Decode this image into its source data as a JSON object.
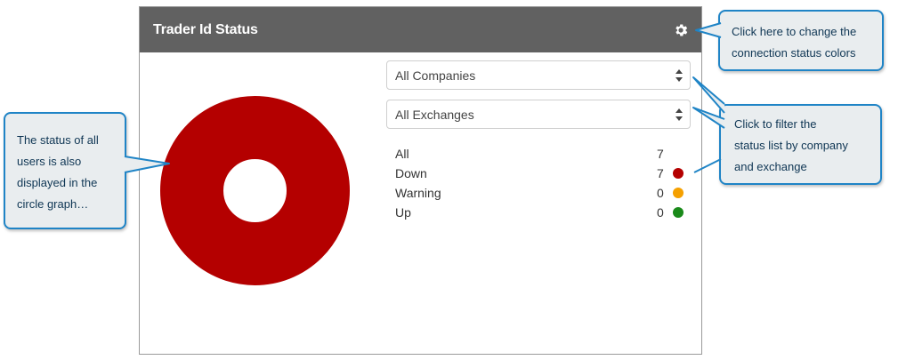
{
  "panel": {
    "title": "Trader Id Status",
    "settings_icon": "gear-icon"
  },
  "filters": {
    "company": {
      "selected": "All Companies"
    },
    "exchange": {
      "selected": "All Exchanges"
    }
  },
  "status_list": [
    {
      "label": "All",
      "count": "7",
      "color": ""
    },
    {
      "label": "Down",
      "count": "7",
      "color": "#b40000"
    },
    {
      "label": "Warning",
      "count": "0",
      "color": "#f5a000"
    },
    {
      "label": "Up",
      "count": "0",
      "color": "#1a8a1a"
    }
  ],
  "donut": {
    "down_fraction": 1.0,
    "color": "#b40000"
  },
  "callouts": {
    "settings": [
      "Click here to change the",
      "connection status colors"
    ],
    "filter": [
      "Click to filter the",
      "status list by company",
      "and exchange"
    ],
    "graph": [
      "The status of all",
      "users is also",
      "displayed in the",
      "circle graph…"
    ]
  },
  "colors": {
    "header": "#616161",
    "callout_border": "#1f84c6",
    "callout_bg": "#e9edef"
  }
}
